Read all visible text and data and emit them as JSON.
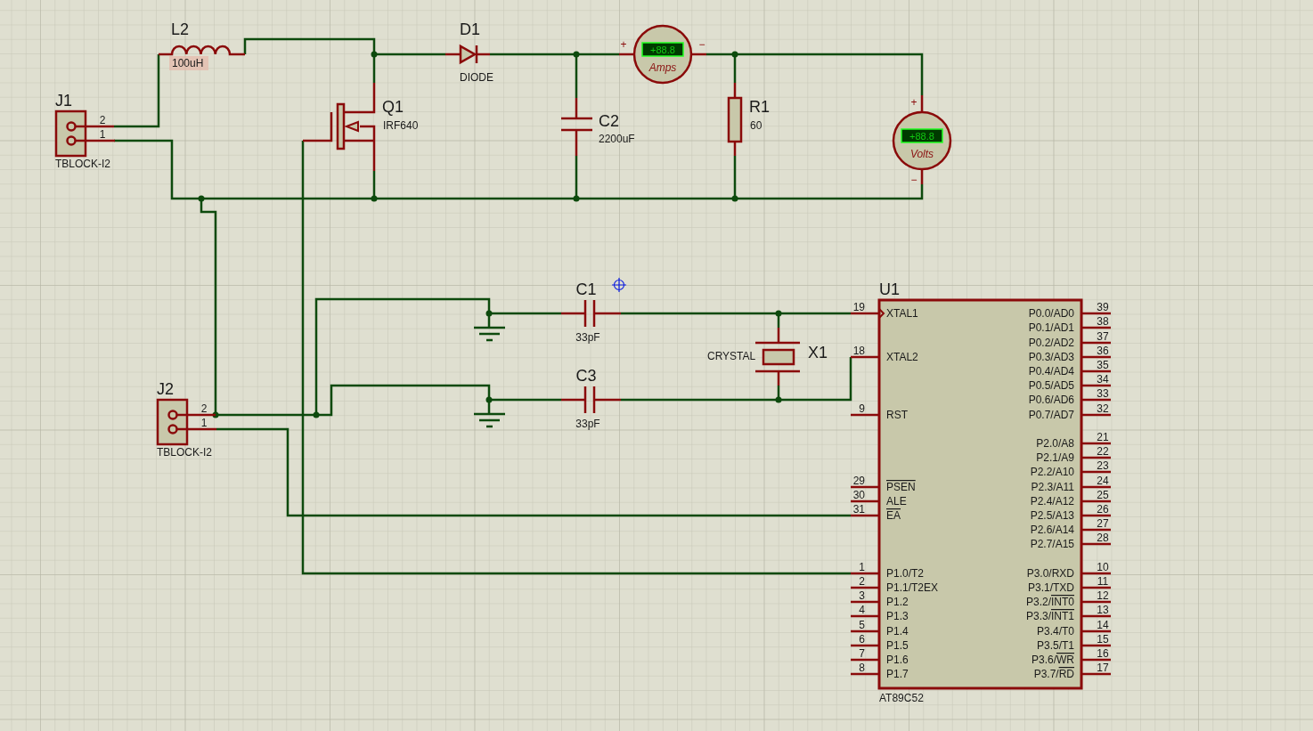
{
  "terminals": [
    {
      "ref": "J1",
      "value": "TBLOCK-I2",
      "pins": [
        "2",
        "1"
      ]
    },
    {
      "ref": "J2",
      "value": "TBLOCK-I2",
      "pins": [
        "2",
        "1"
      ]
    }
  ],
  "inductor": {
    "ref": "L2",
    "value": "100uH"
  },
  "diode": {
    "ref": "D1",
    "value": "DIODE"
  },
  "mosfet": {
    "ref": "Q1",
    "value": "IRF640"
  },
  "capacitors": [
    {
      "ref": "C2",
      "value": "2200uF"
    },
    {
      "ref": "C1",
      "value": "33pF"
    },
    {
      "ref": "C3",
      "value": "33pF"
    }
  ],
  "resistor": {
    "ref": "R1",
    "value": "60"
  },
  "meters": [
    {
      "kind": "ammeter",
      "reading": "+88.8",
      "unit": "Amps",
      "plus": "+",
      "minus": "−"
    },
    {
      "kind": "voltmeter",
      "reading": "+88.8",
      "unit": "Volts",
      "plus": "+",
      "minus": "−"
    }
  ],
  "crystal": {
    "ref": "X1",
    "value": "CRYSTAL"
  },
  "microcontroller": {
    "ref": "U1",
    "part": "AT89C52",
    "left_pins": [
      {
        "number": "19",
        "name": "XTAL1"
      },
      {
        "number": "18",
        "name": "XTAL2"
      },
      {
        "number": "9",
        "name": "RST"
      },
      {
        "number": "29",
        "bar": "PSEN"
      },
      {
        "number": "30",
        "name": "ALE"
      },
      {
        "number": "31",
        "bar": "EA"
      },
      {
        "number": "1",
        "name": "P1.0/T2"
      },
      {
        "number": "2",
        "name": "P1.1/T2EX"
      },
      {
        "number": "3",
        "name": "P1.2"
      },
      {
        "number": "4",
        "name": "P1.3"
      },
      {
        "number": "5",
        "name": "P1.4"
      },
      {
        "number": "6",
        "name": "P1.5"
      },
      {
        "number": "7",
        "name": "P1.6"
      },
      {
        "number": "8",
        "name": "P1.7"
      }
    ],
    "right_pins": [
      {
        "number": "39",
        "name": "P0.0/AD0"
      },
      {
        "number": "38",
        "name": "P0.1/AD1"
      },
      {
        "number": "37",
        "name": "P0.2/AD2"
      },
      {
        "number": "36",
        "name": "P0.3/AD3"
      },
      {
        "number": "35",
        "name": "P0.4/AD4"
      },
      {
        "number": "34",
        "name": "P0.5/AD5"
      },
      {
        "number": "33",
        "name": "P0.6/AD6"
      },
      {
        "number": "32",
        "name": "P0.7/AD7"
      },
      {
        "number": "21",
        "name": "P2.0/A8"
      },
      {
        "number": "22",
        "name": "P2.1/A9"
      },
      {
        "number": "23",
        "name": "P2.2/A10"
      },
      {
        "number": "24",
        "name": "P2.3/A11"
      },
      {
        "number": "25",
        "name": "P2.4/A12"
      },
      {
        "number": "26",
        "name": "P2.5/A13"
      },
      {
        "number": "27",
        "name": "P2.6/A14"
      },
      {
        "number": "28",
        "name": "P2.7/A15"
      },
      {
        "number": "10",
        "name": "P3.0/RXD"
      },
      {
        "number": "11",
        "name": "P3.1/TXD"
      },
      {
        "number": "12",
        "name": "P3.2/",
        "bar": "INT0"
      },
      {
        "number": "13",
        "name": "P3.3/",
        "bar": "INT1"
      },
      {
        "number": "14",
        "name": "P3.4/T0"
      },
      {
        "number": "15",
        "name": "P3.5/T1"
      },
      {
        "number": "16",
        "name": "P3.6/",
        "bar": "WR"
      },
      {
        "number": "17",
        "name": "P3.7/",
        "bar": "RD"
      }
    ]
  }
}
